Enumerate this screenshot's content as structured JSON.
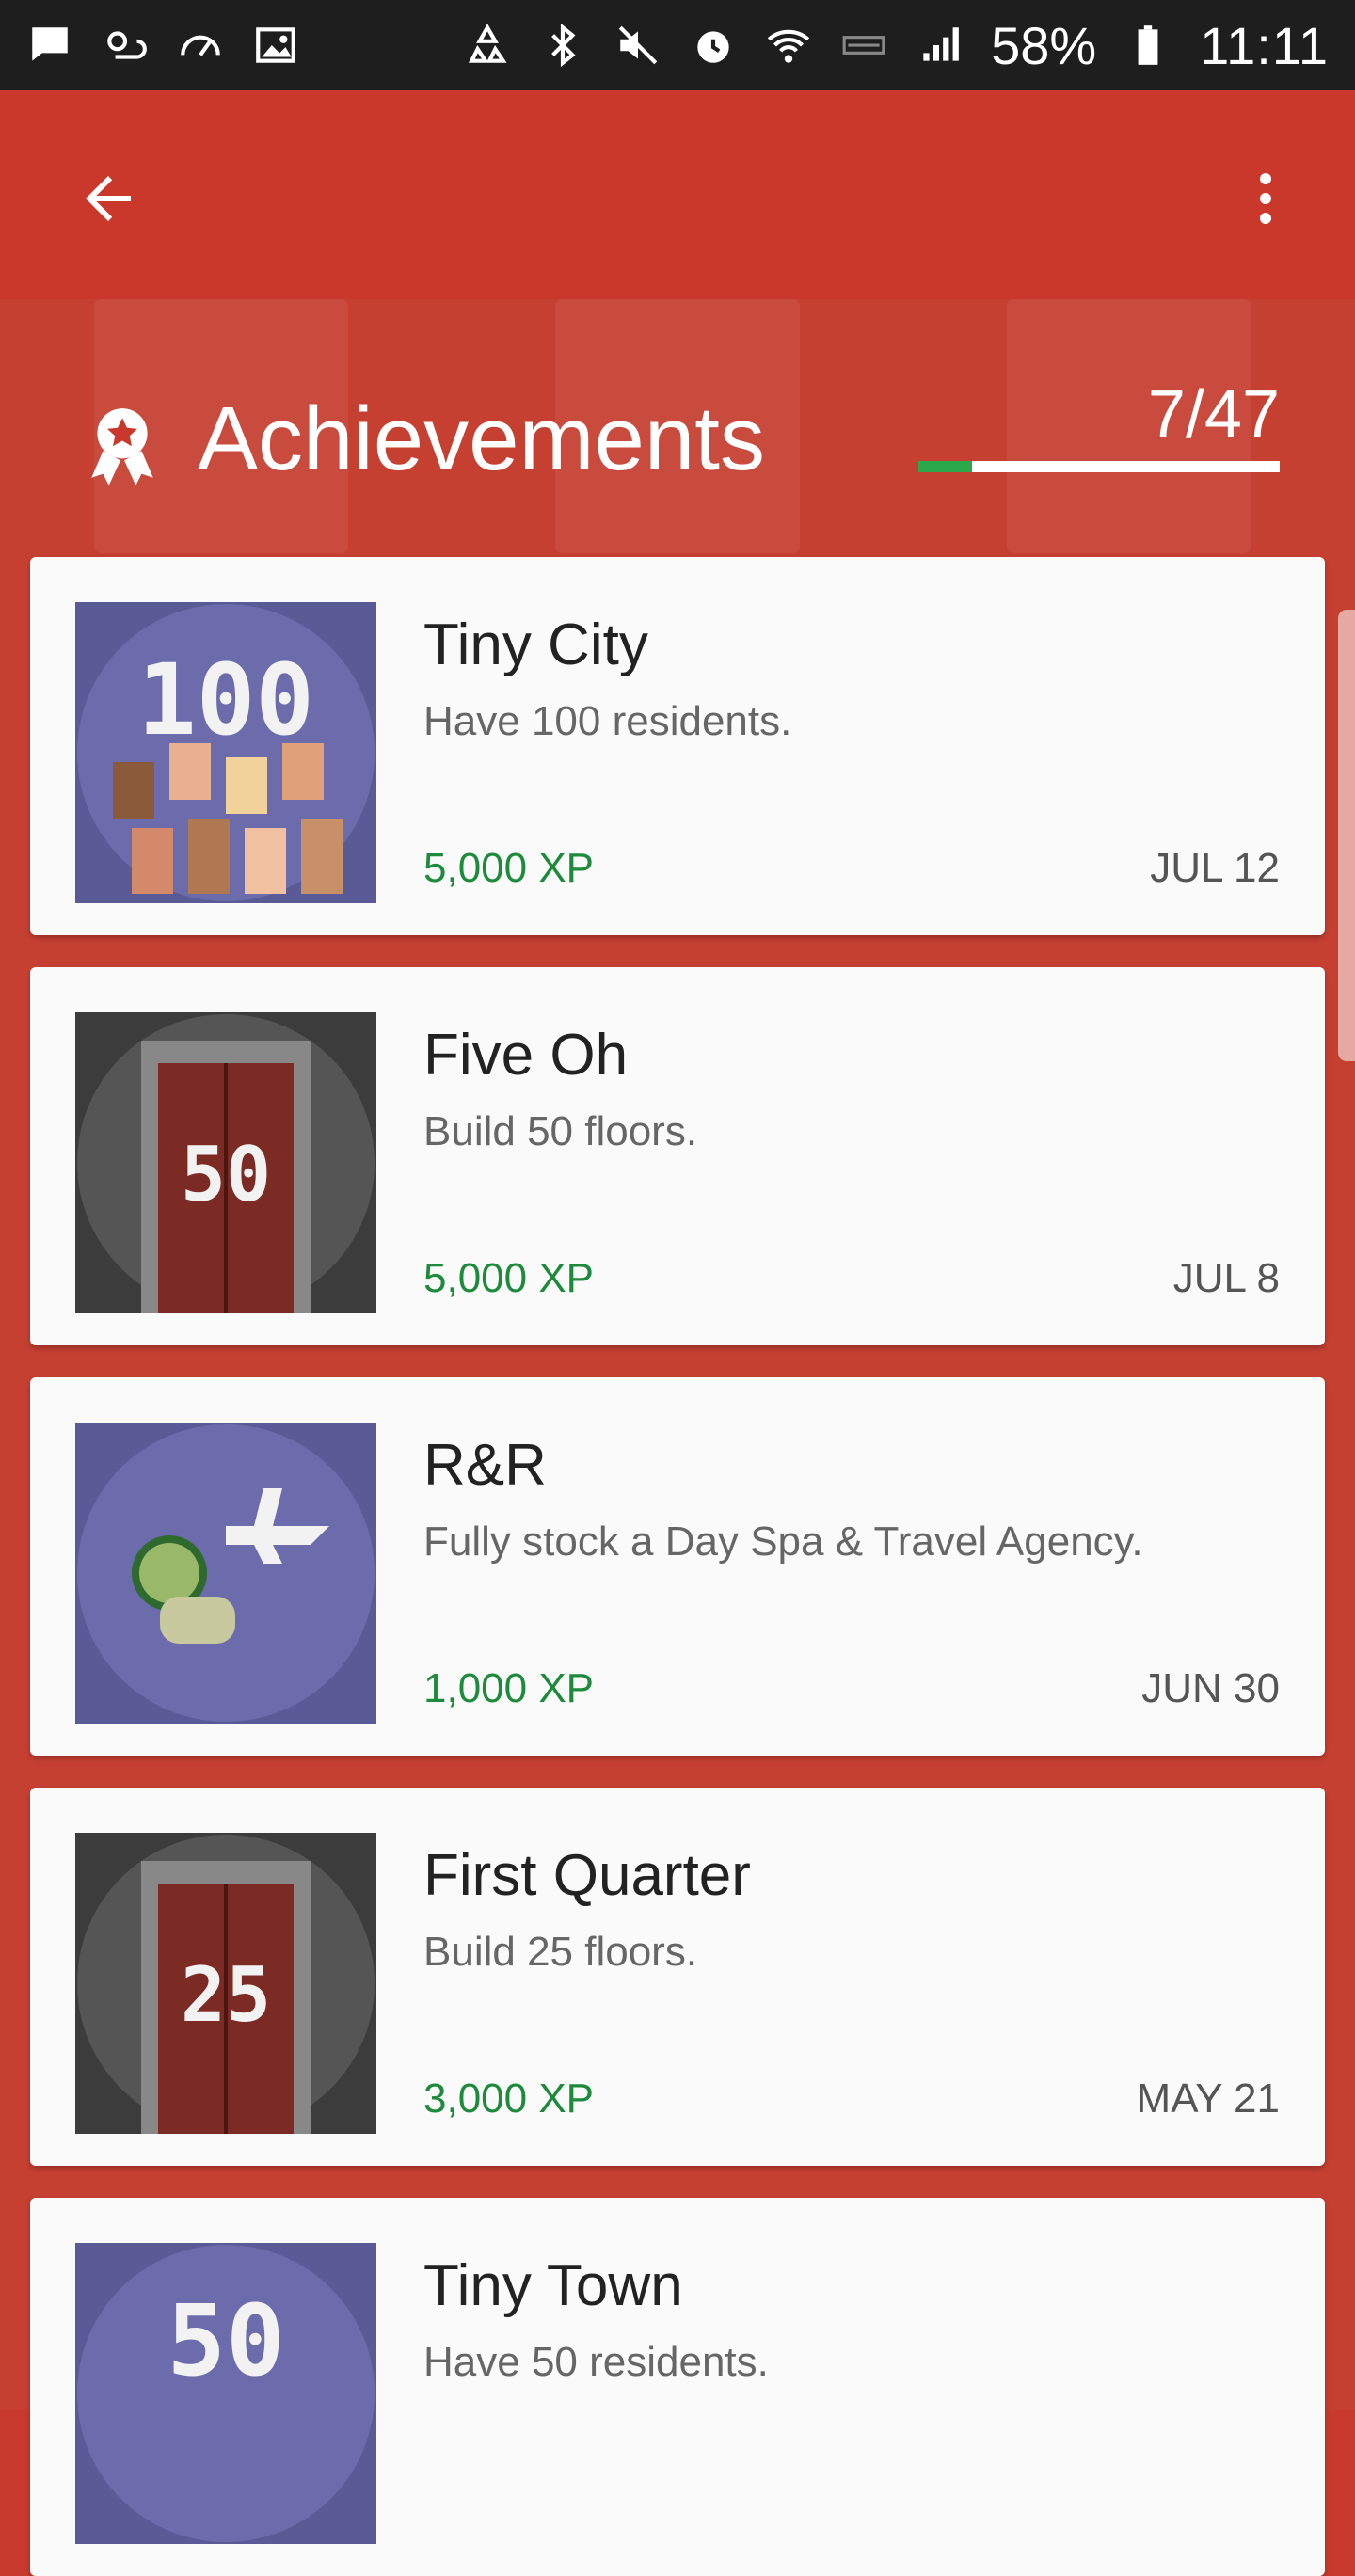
{
  "status_bar": {
    "battery_percent": "58%",
    "time": "11:11",
    "icons": [
      "chat-icon",
      "weather-icon",
      "speedometer-icon",
      "image-icon",
      "recycle-icon",
      "bluetooth-icon",
      "mute-icon",
      "alarm-icon",
      "wifi-icon",
      "volte-icon",
      "signal-icon",
      "battery-icon"
    ]
  },
  "app_bar": {
    "back_icon": "arrow-back-icon",
    "menu_icon": "more-vert-icon"
  },
  "achievements": {
    "title": "Achievements",
    "progress_label": "7/47",
    "progress_fraction": 0.149,
    "colors": {
      "app_bar": "#c9382b",
      "progress_fill": "#2aa84a",
      "xp_text": "#1e8a3c"
    }
  },
  "items": [
    {
      "title": "Tiny City",
      "description": "Have 100 residents.",
      "xp": "5,000 XP",
      "date": "JUL 12",
      "badge": "100"
    },
    {
      "title": "Five Oh",
      "description": "Build 50 floors.",
      "xp": "5,000 XP",
      "date": "JUL 8",
      "badge": "50"
    },
    {
      "title": "R&R",
      "description": "Fully stock a Day Spa & Travel Agency.",
      "xp": "1,000 XP",
      "date": "JUN 30",
      "badge": ""
    },
    {
      "title": "First Quarter",
      "description": "Build 25 floors.",
      "xp": "3,000 XP",
      "date": "MAY 21",
      "badge": "25"
    },
    {
      "title": "Tiny Town",
      "description": "Have 50 residents.",
      "xp": "",
      "date": "",
      "badge": "50"
    }
  ]
}
